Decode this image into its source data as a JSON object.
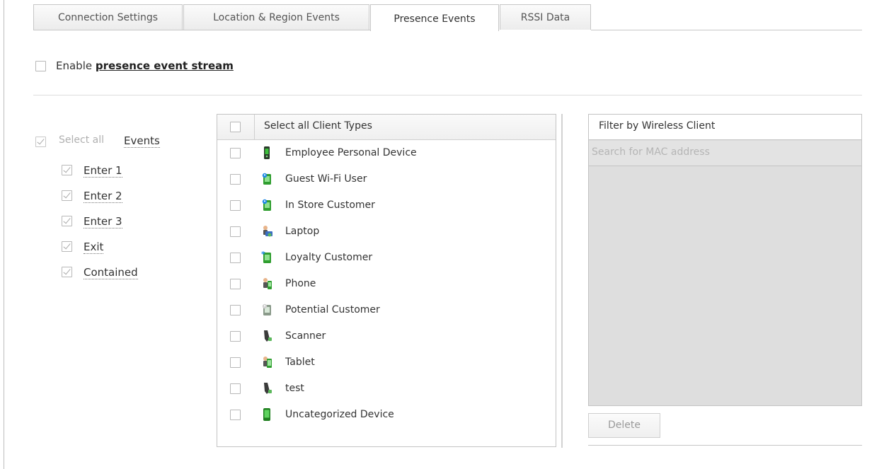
{
  "tabs": [
    {
      "label": "Connection Settings",
      "active": false
    },
    {
      "label": "Location & Region Events",
      "active": false
    },
    {
      "label": "Presence Events",
      "active": true
    },
    {
      "label": "RSSI Data",
      "active": false
    }
  ],
  "enable": {
    "prefix": "Enable ",
    "link": "presence event stream",
    "checked": false
  },
  "events": {
    "select_all_label": "Select all",
    "title": "Events",
    "items": [
      {
        "label": "Enter 1",
        "checked": true
      },
      {
        "label": "Enter 2",
        "checked": true
      },
      {
        "label": "Enter 3",
        "checked": true
      },
      {
        "label": "Exit",
        "checked": true
      },
      {
        "label": "Contained",
        "checked": true
      }
    ]
  },
  "client_types": {
    "header": "Select all Client Types",
    "items": [
      {
        "label": "Employee Personal Device",
        "icon": "employee-device-icon"
      },
      {
        "label": "Guest Wi-Fi User",
        "icon": "guest-user-icon"
      },
      {
        "label": "In Store Customer",
        "icon": "store-customer-icon"
      },
      {
        "label": "Laptop",
        "icon": "laptop-icon"
      },
      {
        "label": "Loyalty Customer",
        "icon": "loyalty-customer-icon"
      },
      {
        "label": "Phone",
        "icon": "phone-icon"
      },
      {
        "label": "Potential Customer",
        "icon": "potential-customer-icon"
      },
      {
        "label": "Scanner",
        "icon": "scanner-icon"
      },
      {
        "label": "Tablet",
        "icon": "tablet-icon"
      },
      {
        "label": "test",
        "icon": "scanner-icon"
      },
      {
        "label": "Uncategorized Device",
        "icon": "uncategorized-device-icon"
      }
    ]
  },
  "filter": {
    "header": "Filter by Wireless Client",
    "search_placeholder": "Search for MAC address",
    "delete_label": "Delete"
  },
  "colors": {
    "muted": "#9a9a9a",
    "border": "#c3c3c3",
    "filter_bg": "#dedede"
  }
}
